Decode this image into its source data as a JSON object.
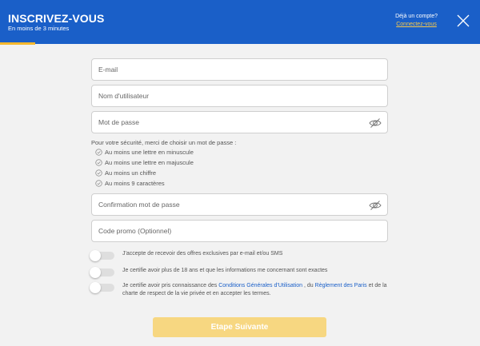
{
  "header": {
    "title": "INSCRIVEZ-VOUS",
    "subtitle": "En moins de 3 minutes",
    "already_account": "Déjà un compte?",
    "login_link": "Connectez-vous",
    "close_icon": "close-icon",
    "brand_color": "#1a5fc8",
    "progress_color": "#f5b82e"
  },
  "form": {
    "email_placeholder": "E-mail",
    "username_placeholder": "Nom d'utilisateur",
    "password_placeholder": "Mot de passe",
    "password_intro": "Pour votre sécurité, merci de choisir un mot de passe :",
    "password_rules": [
      "Au moins une lettre en minuscule",
      "Au moins une lettre en majuscule",
      "Au moins un chiffre",
      "Au moins 9 caractères"
    ],
    "confirm_placeholder": "Confirmation mot de passe",
    "promo_placeholder": "Code promo (Optionnel)",
    "eye_icon": "eye-slash-icon"
  },
  "consents": {
    "offers": "J'accepte de recevoir des offres exclusives par e-mail et/ou SMS",
    "age": "Je certifie avoir plus de 18 ans et que les informations me concernant sont exactes",
    "terms_prefix": "Je certifie avoir pris connaissance des ",
    "terms_link": "Conditions Générales d'Utilisation",
    "terms_middle": " , du ",
    "rules_link": "Règlement des Paris",
    "terms_suffix": " et de la charte de respect de la vie privée et en accepter les termes."
  },
  "footer": {
    "next_label": "Etape Suivante",
    "next_color": "#f7d781"
  }
}
